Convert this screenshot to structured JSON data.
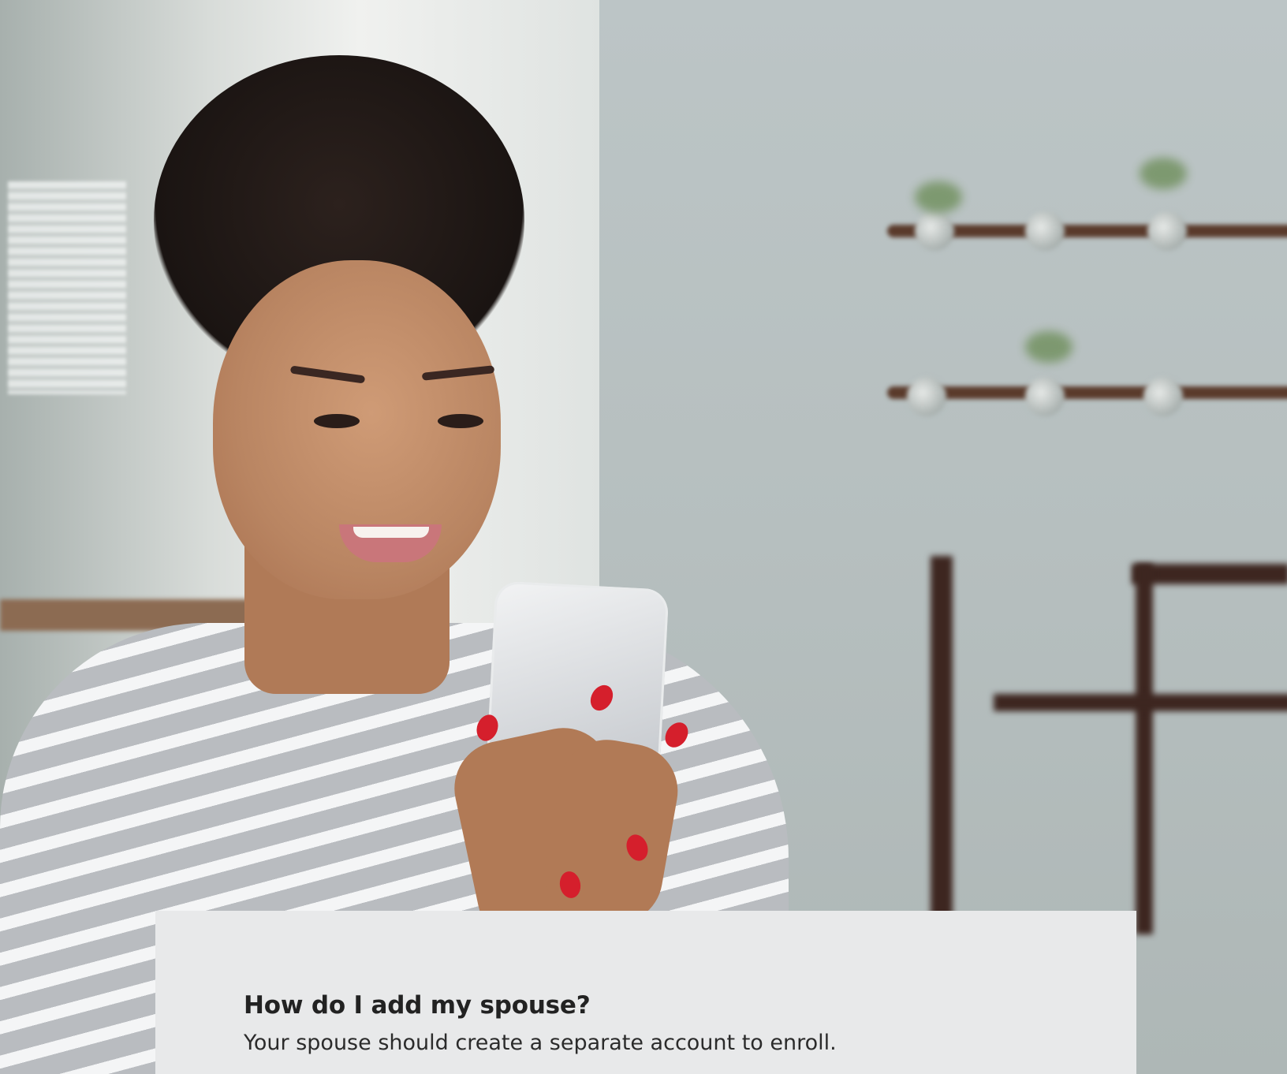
{
  "faq": {
    "question": "How do I add my spouse?",
    "answer": "Your spouse should create a separate account to enroll."
  },
  "hero_image": {
    "subject": "Woman smiling at phone",
    "icon": "photo-icon"
  },
  "colors": {
    "card_background": "#e8e9ea",
    "text_primary": "#222222",
    "nail_accent": "#d51f2c"
  }
}
